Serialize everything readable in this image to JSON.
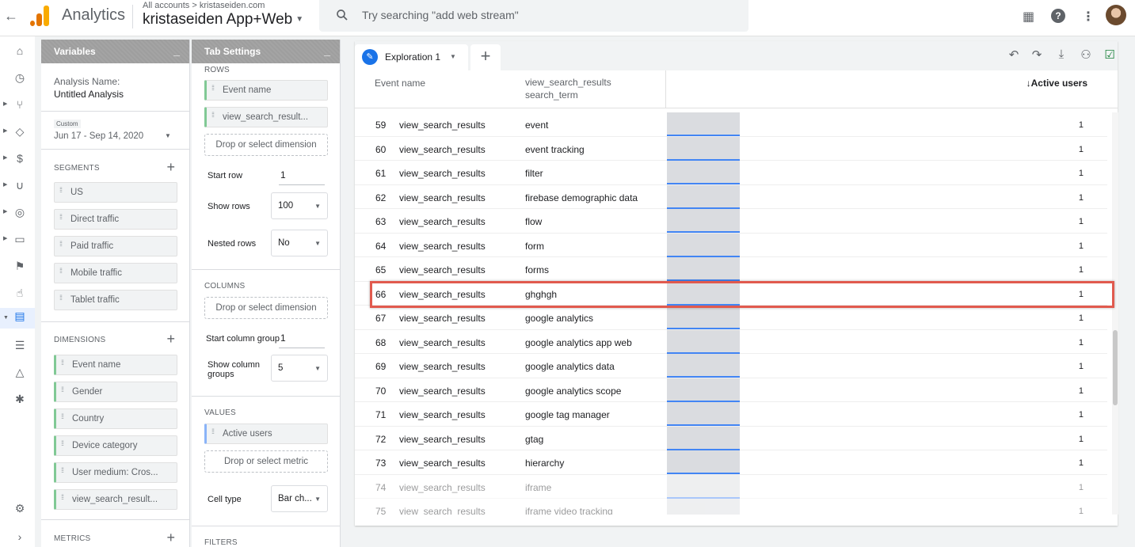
{
  "topbar": {
    "product_name": "Analytics",
    "breadcrumb": "All accounts > kristaseiden.com",
    "property_name": "kristaseiden App+Web",
    "search_placeholder": "Try searching \"add web stream\""
  },
  "variables_panel": {
    "title": "Variables",
    "analysis_name_label": "Analysis Name:",
    "analysis_name_value": "Untitled Analysis",
    "date_badge": "Custom",
    "date_range": "Jun 17 - Sep 14, 2020",
    "segments_label": "SEGMENTS",
    "segments": [
      "US",
      "Direct traffic",
      "Paid traffic",
      "Mobile traffic",
      "Tablet traffic"
    ],
    "dimensions_label": "DIMENSIONS",
    "dimensions": [
      "Event name",
      "Gender",
      "Country",
      "Device category",
      "User medium: Cros...",
      "view_search_result..."
    ],
    "metrics_label": "METRICS"
  },
  "tab_settings": {
    "title": "Tab Settings",
    "rows_label": "ROWS",
    "rows": [
      "Event name",
      "view_search_result..."
    ],
    "drop_dimension": "Drop or select dimension",
    "start_row_label": "Start row",
    "start_row_value": "1",
    "show_rows_label": "Show rows",
    "show_rows_value": "100",
    "nested_rows_label": "Nested rows",
    "nested_rows_value": "No",
    "columns_label": "COLUMNS",
    "start_col_label": "Start column group",
    "start_col_value": "1",
    "show_col_label": "Show column groups",
    "show_col_value": "5",
    "values_label": "VALUES",
    "values": [
      "Active users"
    ],
    "drop_metric": "Drop or select metric",
    "cell_type_label": "Cell type",
    "cell_type_value": "Bar ch...",
    "filters_label": "FILTERS"
  },
  "exploration": {
    "tab_label": "Exploration 1",
    "col_event": "Event name",
    "col_search_1": "view_search_results",
    "col_search_2": "search_term",
    "col_users": "↓Active users",
    "rows": [
      {
        "num": "59",
        "event": "view_search_results",
        "term": "event",
        "users": "1"
      },
      {
        "num": "60",
        "event": "view_search_results",
        "term": "event tracking",
        "users": "1"
      },
      {
        "num": "61",
        "event": "view_search_results",
        "term": "filter",
        "users": "1"
      },
      {
        "num": "62",
        "event": "view_search_results",
        "term": "firebase demographic data",
        "users": "1"
      },
      {
        "num": "63",
        "event": "view_search_results",
        "term": "flow",
        "users": "1"
      },
      {
        "num": "64",
        "event": "view_search_results",
        "term": "form",
        "users": "1"
      },
      {
        "num": "65",
        "event": "view_search_results",
        "term": "forms",
        "users": "1"
      },
      {
        "num": "66",
        "event": "view_search_results",
        "term": "ghghgh",
        "users": "1"
      },
      {
        "num": "67",
        "event": "view_search_results",
        "term": "google analytics",
        "users": "1"
      },
      {
        "num": "68",
        "event": "view_search_results",
        "term": "google analytics app web",
        "users": "1"
      },
      {
        "num": "69",
        "event": "view_search_results",
        "term": "google analytics data",
        "users": "1"
      },
      {
        "num": "70",
        "event": "view_search_results",
        "term": "google analytics scope",
        "users": "1"
      },
      {
        "num": "71",
        "event": "view_search_results",
        "term": "google tag manager",
        "users": "1"
      },
      {
        "num": "72",
        "event": "view_search_results",
        "term": "gtag",
        "users": "1"
      },
      {
        "num": "73",
        "event": "view_search_results",
        "term": "hierarchy",
        "users": "1"
      },
      {
        "num": "74",
        "event": "view_search_results",
        "term": "iframe",
        "users": "1"
      },
      {
        "num": "75",
        "event": "view_search_results",
        "term": "iframe video tracking",
        "users": "1"
      }
    ]
  },
  "colors": {
    "accent": "#1a73e8",
    "highlight_border": "#e15a4e",
    "bar": "#4285f4"
  }
}
